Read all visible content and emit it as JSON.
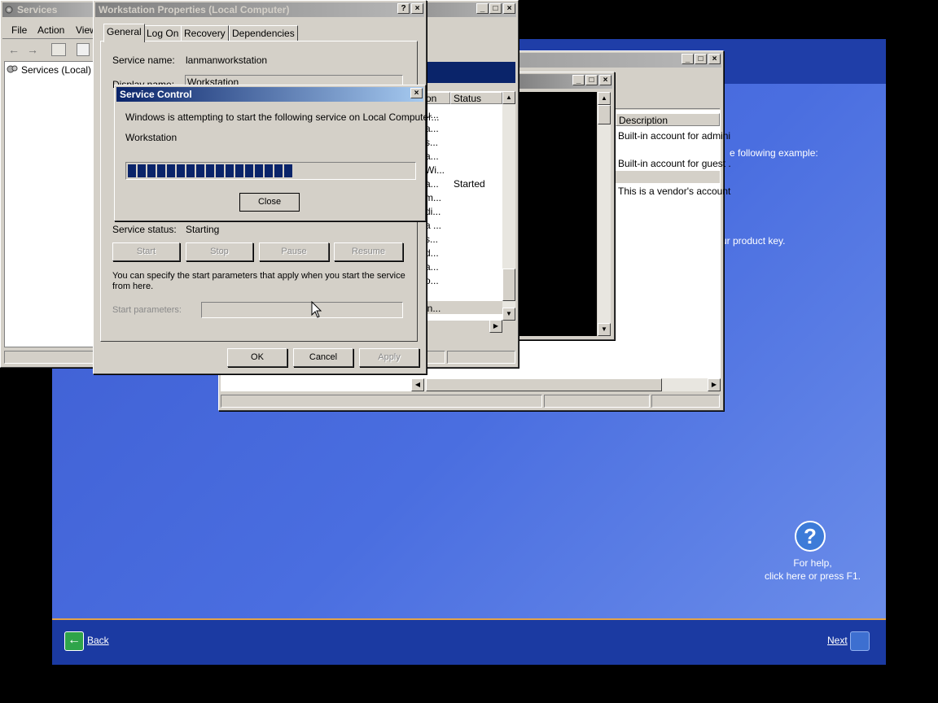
{
  "oobe": {
    "text_example": "e following example:",
    "text_product_key": "ur product key.",
    "help_line1": "For help,",
    "help_line2": "click here or press F1.",
    "back_label": "Back",
    "next_label": "Next"
  },
  "services_window": {
    "title": "Services",
    "menu": [
      "File",
      "Action",
      "View"
    ],
    "tree_item": "Services (Local)"
  },
  "list_window": {
    "col_header_partial": "on",
    "col_header_status": "Status",
    "rows": [
      "u...",
      "a...",
      "s...",
      "a...",
      "Wi...",
      "a...",
      "m...",
      "di...",
      "a ...",
      "s...",
      "d...",
      "a...",
      "o...",
      "in..."
    ],
    "started_text": "Started"
  },
  "users_window": {
    "desc_header": "Description",
    "desc_rows": [
      "Built-in account for admini",
      "Built-in account for guest .",
      "This is a vendor's account"
    ]
  },
  "properties": {
    "title": "Workstation Properties (Local Computer)",
    "tabs": [
      "General",
      "Log On",
      "Recovery",
      "Dependencies"
    ],
    "service_name_label": "Service name:",
    "service_name_value": "lanmanworkstation",
    "display_name_label": "Display name:",
    "display_name_value": "Workstation",
    "status_label": "Service status:",
    "status_value": "Starting",
    "start": "Start",
    "stop": "Stop",
    "pause": "Pause",
    "resume": "Resume",
    "params_text": "You can specify the start parameters that apply when you start the service from here.",
    "params_label": "Start parameters:",
    "ok": "OK",
    "cancel": "Cancel",
    "apply": "Apply"
  },
  "service_control": {
    "title": "Service Control",
    "message": "Windows is attempting to start the following service on Local Computer...",
    "service": "Workstation",
    "progress": 0.6,
    "close": "Close"
  }
}
